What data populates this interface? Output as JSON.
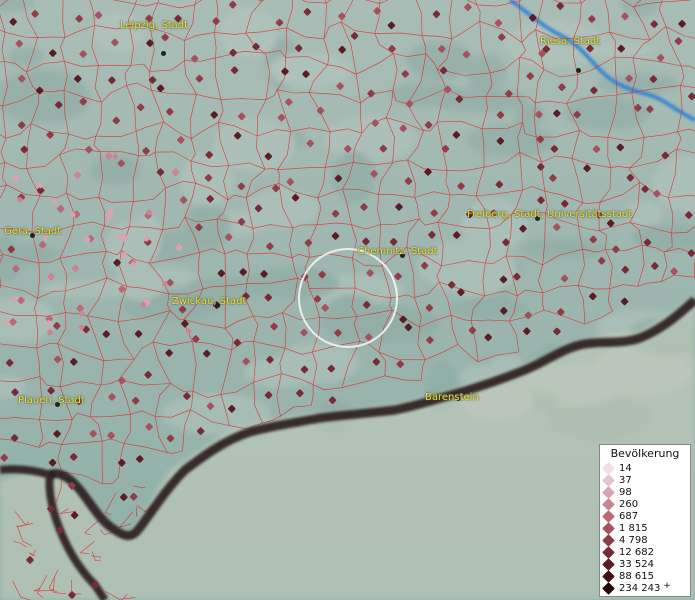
{
  "map": {
    "river_color": "#2b7fd6",
    "boundary_color": "#e02020",
    "border_color": "#1a1010",
    "marker_style": "diamond",
    "highlight": "circle"
  },
  "cities": [
    {
      "name": "Leipzig, Stadt"
    },
    {
      "name": "Riesa, Stadt"
    },
    {
      "name": "Gera, Stadt"
    },
    {
      "name": "Chemnitz, Stadt"
    },
    {
      "name": "Freiberg, Stadt, Universitätsstadt"
    },
    {
      "name": "Zwickau, Stadt"
    },
    {
      "name": "Plauen, Stadt"
    },
    {
      "name": "Bärenstein"
    }
  ],
  "legend": {
    "title": "Bevölkerung",
    "items": [
      {
        "label": "14",
        "color": "#f3dde6"
      },
      {
        "label": "37",
        "color": "#e7c2cf"
      },
      {
        "label": "98",
        "color": "#d9a3b1"
      },
      {
        "label": "260",
        "color": "#c98594"
      },
      {
        "label": "687",
        "color": "#b86a78"
      },
      {
        "label": "1 815",
        "color": "#a5525f"
      },
      {
        "label": "4 798",
        "color": "#8f3d49"
      },
      {
        "label": "12 682",
        "color": "#762b36"
      },
      {
        "label": "33 524",
        "color": "#5c1c25"
      },
      {
        "label": "88 615",
        "color": "#421117"
      },
      {
        "label": "234 243",
        "color": "#230608",
        "plus": "+"
      }
    ]
  }
}
